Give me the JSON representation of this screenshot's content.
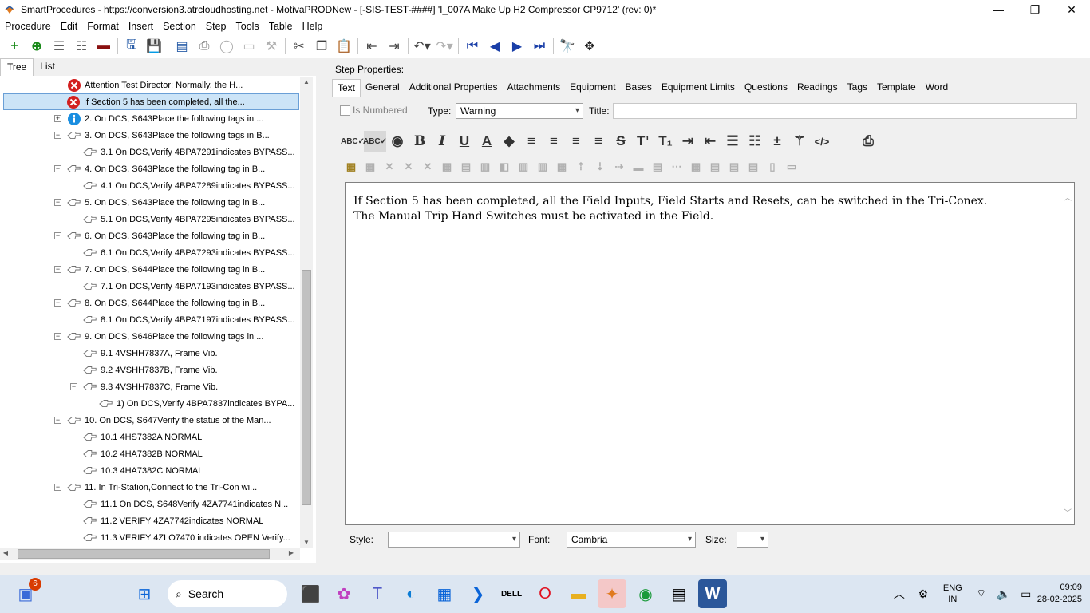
{
  "window": {
    "title": "SmartProcedures - https://conversion3.atrcloudhosting.net - MotivaPRODNew - [-SIS-TEST-####] 'I_007A Make Up H2 Compressor CP9712' (rev: 0)*",
    "minimize": "—",
    "maximize": "❐",
    "close": "✕"
  },
  "menu": [
    "Procedure",
    "Edit",
    "Format",
    "Insert",
    "Section",
    "Step",
    "Tools",
    "Table",
    "Help"
  ],
  "left_tabs": [
    "Tree",
    "List"
  ],
  "tree": [
    {
      "text": "Attention Test Director: Normally, the H...",
      "icon": "error-icon",
      "indent": 84,
      "expand": ""
    },
    {
      "text": "If Section 5 has been completed, all the...",
      "icon": "error-icon",
      "indent": 84,
      "expand": "",
      "selected": true
    },
    {
      "text": "2. On DCS, S643Place the following tags in ...",
      "icon": "info-icon",
      "indent": 84,
      "expand": "+"
    },
    {
      "text": "3. On DCS, S643Place the following tags in B...",
      "icon": "hand-icon",
      "indent": 84,
      "expand": "−"
    },
    {
      "text": "3.1  On DCS,Verify  4BPA7291indicates BYPASS...",
      "icon": "hand-icon",
      "indent": 104,
      "expand": ""
    },
    {
      "text": "4. On DCS, S643Place the following tag in B...",
      "icon": "hand-icon",
      "indent": 84,
      "expand": "−"
    },
    {
      "text": "4.1  On DCS,Verify  4BPA7289indicates BYPASS...",
      "icon": "hand-icon",
      "indent": 104,
      "expand": ""
    },
    {
      "text": "5. On DCS, S643Place the following tag in B...",
      "icon": "hand-icon",
      "indent": 84,
      "expand": "−"
    },
    {
      "text": "5.1  On DCS,Verify  4BPA7295indicates BYPASS...",
      "icon": "hand-icon",
      "indent": 104,
      "expand": ""
    },
    {
      "text": "6. On DCS, S643Place the following tag in B...",
      "icon": "hand-icon",
      "indent": 84,
      "expand": "−"
    },
    {
      "text": "6.1  On DCS,Verify  4BPA7293indicates BYPASS...",
      "icon": "hand-icon",
      "indent": 104,
      "expand": ""
    },
    {
      "text": "7. On DCS, S644Place the following tag in B...",
      "icon": "hand-icon",
      "indent": 84,
      "expand": "−"
    },
    {
      "text": "7.1  On DCS,Verify  4BPA7193indicates BYPASS...",
      "icon": "hand-icon",
      "indent": 104,
      "expand": ""
    },
    {
      "text": "8. On DCS, S644Place the following tag in B...",
      "icon": "hand-icon",
      "indent": 84,
      "expand": "−"
    },
    {
      "text": "8.1  On DCS,Verify  4BPA7197indicates BYPASS...",
      "icon": "hand-icon",
      "indent": 104,
      "expand": ""
    },
    {
      "text": "9. On DCS, S646Place the following tags in ...",
      "icon": "hand-icon",
      "indent": 84,
      "expand": "−"
    },
    {
      "text": "9.1 4VSHH7837A, Frame Vib.",
      "icon": "hand-icon",
      "indent": 104,
      "expand": ""
    },
    {
      "text": "9.2 4VSHH7837B, Frame Vib.",
      "icon": "hand-icon",
      "indent": 104,
      "expand": ""
    },
    {
      "text": "9.3 4VSHH7837C, Frame Vib.",
      "icon": "hand-icon",
      "indent": 104,
      "expand": "−"
    },
    {
      "text": "1)  On DCS,Verify  4BPA7837indicates  BYPA...",
      "icon": "hand-icon",
      "indent": 124,
      "expand": ""
    },
    {
      "text": "10. On DCS, S647Verify the status of the Man...",
      "icon": "hand-icon",
      "indent": 84,
      "expand": "−"
    },
    {
      "text": "10.1 4HS7382A        NORMAL",
      "icon": "hand-icon",
      "indent": 104,
      "expand": ""
    },
    {
      "text": "10.2 4HA7382B        NORMAL",
      "icon": "hand-icon",
      "indent": 104,
      "expand": ""
    },
    {
      "text": "10.3 4HA7382C        NORMAL",
      "icon": "hand-icon",
      "indent": 104,
      "expand": ""
    },
    {
      "text": "11. In Tri-Station,Connect to the Tri-Con wi...",
      "icon": "hand-icon",
      "indent": 84,
      "expand": "−"
    },
    {
      "text": "11.1  On DCS,  S648Verify  4ZA7741indicates  N...",
      "icon": "hand-icon",
      "indent": 104,
      "expand": ""
    },
    {
      "text": "11.2  VERIFY 4ZA7742indicates NORMAL",
      "icon": "hand-icon",
      "indent": 104,
      "expand": ""
    },
    {
      "text": "11.3  VERIFY  4ZLO7470   indicates  OPEN Verify...",
      "icon": "hand-icon",
      "indent": 104,
      "expand": ""
    }
  ],
  "step_properties": {
    "heading": "Step Properties:",
    "tabs": [
      "Text",
      "General",
      "Additional Properties",
      "Attachments",
      "Equipment",
      "Bases",
      "Equipment Limits",
      "Questions",
      "Readings",
      "Tags",
      "Template",
      "Word"
    ],
    "is_numbered_label": "Is Numbered",
    "type_label": "Type:",
    "type_value": "Warning",
    "title_label": "Title:",
    "title_value": "",
    "body_line1": "If Section 5 has been completed, all the Field Inputs, Field Starts and Resets, can be switched in the Tri-Conex.",
    "body_line2": "The Manual Trip Hand Switches must be activated in the Field.",
    "style_label": "Style:",
    "style_value": "",
    "font_label": "Font:",
    "font_value": "Cambria",
    "size_label": "Size:",
    "size_value": ""
  },
  "taskbar": {
    "search_placeholder": "Search",
    "notification_count": "6",
    "lang_line1": "ENG",
    "lang_line2": "IN",
    "time": "09:09",
    "date": "28-02-2025"
  }
}
